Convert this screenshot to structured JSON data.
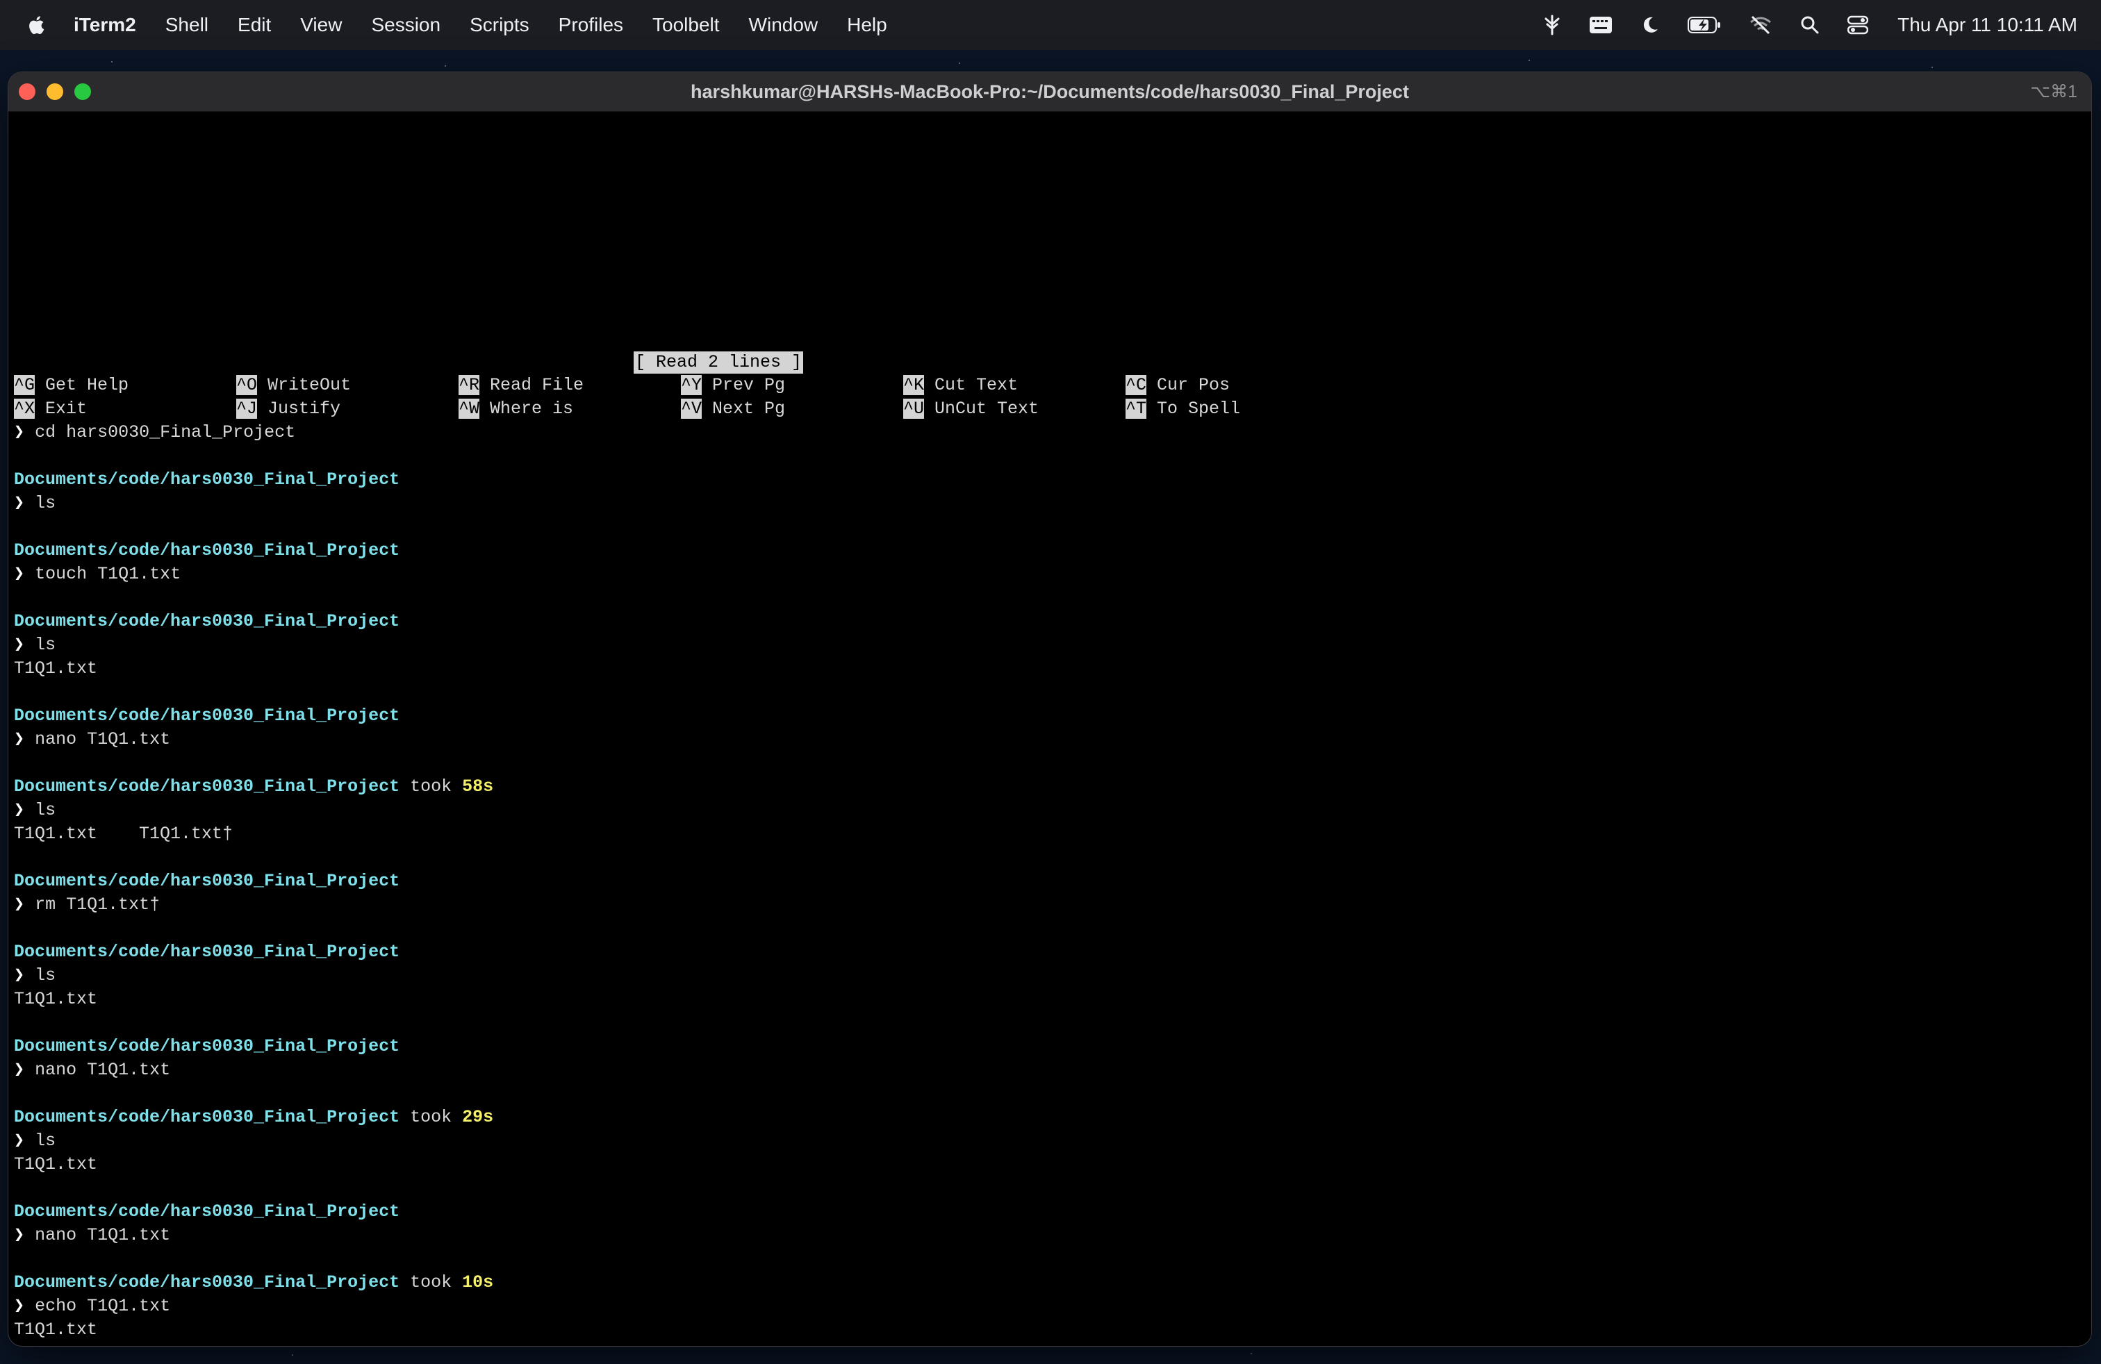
{
  "menubar": {
    "apple_icon": "apple-logo",
    "items": [
      "iTerm2",
      "Shell",
      "Edit",
      "View",
      "Session",
      "Scripts",
      "Profiles",
      "Toolbelt",
      "Window",
      "Help"
    ],
    "tray_icons": [
      "fork-icon",
      "keyboard-icon",
      "moon-icon",
      "battery-icon",
      "wifi-off-icon",
      "search-icon",
      "control-center-icon"
    ],
    "clock": "Thu Apr 11  10:11 AM"
  },
  "window": {
    "title": "harshkumar@HARSHs-MacBook-Pro:~/Documents/code/hars0030_Final_Project",
    "shortcut": "⌥⌘1"
  },
  "terminal": {
    "nano_status": "[ Read 2 lines ]",
    "nano_row1": [
      {
        "key": "^G",
        "label": "Get Help"
      },
      {
        "key": "^O",
        "label": "WriteOut"
      },
      {
        "key": "^R",
        "label": "Read File"
      },
      {
        "key": "^Y",
        "label": "Prev Pg"
      },
      {
        "key": "^K",
        "label": "Cut Text"
      },
      {
        "key": "^C",
        "label": "Cur Pos"
      }
    ],
    "nano_row2": [
      {
        "key": "^X",
        "label": "Exit"
      },
      {
        "key": "^J",
        "label": "Justify"
      },
      {
        "key": "^W",
        "label": "Where is"
      },
      {
        "key": "^V",
        "label": "Next Pg"
      },
      {
        "key": "^U",
        "label": "UnCut Text"
      },
      {
        "key": "^T",
        "label": "To Spell"
      }
    ],
    "prompt_symbol": "❯",
    "path": "Documents/code/hars0030_Final_Project",
    "took_label": "took",
    "lines": [
      {
        "type": "cmd",
        "text": "cd hars0030_Final_Project"
      },
      {
        "type": "path"
      },
      {
        "type": "cmd",
        "text": "ls"
      },
      {
        "type": "path"
      },
      {
        "type": "cmd",
        "text": "touch T1Q1.txt"
      },
      {
        "type": "path"
      },
      {
        "type": "cmd",
        "text": "ls"
      },
      {
        "type": "out",
        "text": "T1Q1.txt"
      },
      {
        "type": "path"
      },
      {
        "type": "cmd",
        "text": "nano T1Q1.txt"
      },
      {
        "type": "path",
        "took": "58s"
      },
      {
        "type": "cmd",
        "text": "ls"
      },
      {
        "type": "out",
        "text": "T1Q1.txt    T1Q1.txt†"
      },
      {
        "type": "path"
      },
      {
        "type": "cmd",
        "text": "rm T1Q1.txt†"
      },
      {
        "type": "path"
      },
      {
        "type": "cmd",
        "text": "ls"
      },
      {
        "type": "out",
        "text": "T1Q1.txt"
      },
      {
        "type": "path"
      },
      {
        "type": "cmd",
        "text": "nano T1Q1.txt"
      },
      {
        "type": "path",
        "took": "29s"
      },
      {
        "type": "cmd",
        "text": "ls"
      },
      {
        "type": "out",
        "text": "T1Q1.txt"
      },
      {
        "type": "path"
      },
      {
        "type": "cmd",
        "text": "nano T1Q1.txt"
      },
      {
        "type": "path",
        "took": "10s"
      },
      {
        "type": "cmd",
        "text": "echo T1Q1.txt"
      },
      {
        "type": "out",
        "text": "T1Q1.txt"
      },
      {
        "type": "path"
      },
      {
        "type": "input"
      }
    ]
  }
}
